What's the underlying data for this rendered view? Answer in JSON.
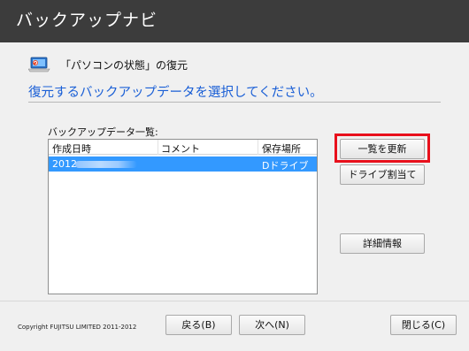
{
  "app": {
    "title": "バックアップナビ"
  },
  "header": {
    "breadcrumb": "「パソコンの状態」の復元",
    "instruction": "復元するバックアップデータを選択してください。"
  },
  "backup_list": {
    "label": "バックアップデータ一覧:",
    "columns": [
      "作成日時",
      "コメント",
      "保存場所"
    ],
    "rows": [
      {
        "created": "2012",
        "comment": "",
        "location": "Dドライブ",
        "selected": true
      }
    ]
  },
  "side_buttons": {
    "refresh": "一覧を更新",
    "drive_assign": "ドライブ割当て",
    "details": "詳細情報"
  },
  "footer": {
    "copyright": "Copyright FUJITSU LIMITED 2011-2012",
    "back": "戻る(B)",
    "next": "次へ(N)",
    "close": "閉じる(C)"
  },
  "colors": {
    "title_bar": "#3c3c3c",
    "instruction_text": "#1a5fd6",
    "selection": "#3399ff",
    "highlight_box": "#e8101c"
  },
  "icons": {
    "header": "laptop-restore-icon"
  }
}
